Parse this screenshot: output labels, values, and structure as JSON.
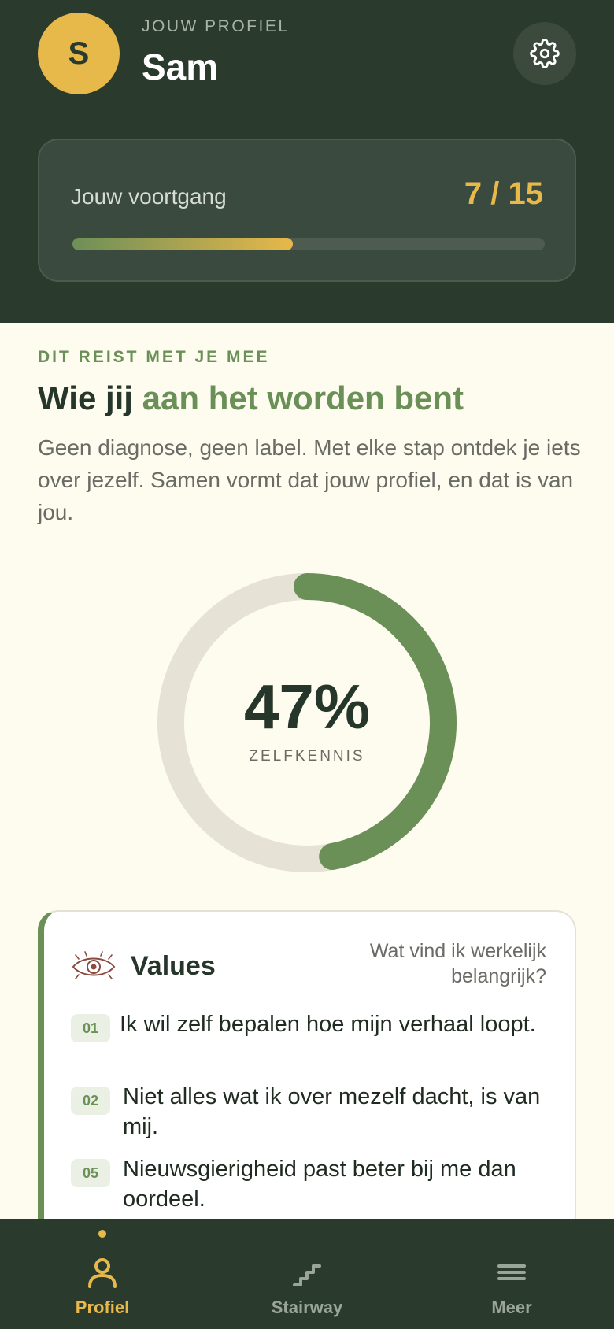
{
  "profile": {
    "avatar_initial": "S",
    "kicker": "JOUW PROFIEL",
    "name": "Sam"
  },
  "progress": {
    "label": "Jouw voortgang",
    "count": "7 / 15",
    "fraction": 0.4667
  },
  "intro": {
    "kicker": "DIT REIST MET JE MEE",
    "headline_plain": "Wie jij ",
    "headline_accent": "aan het worden bent",
    "body": "Geen diagnose, geen label. Met elke stap ontdek je iets over jezelf. Samen vormt dat jouw profiel, en dat is van jou."
  },
  "self_knowledge": {
    "value_text": "47%",
    "percent": 47,
    "label": "ZELFKENNIS"
  },
  "values_card": {
    "icon": "eye-icon",
    "title": "Values",
    "question": "Wat vind ik werkelijk belangrijk?",
    "items": [
      {
        "num": "01",
        "text": "Ik wil zelf bepalen hoe mijn verhaal loopt."
      },
      {
        "num": "02",
        "text": "Niet alles wat ik over mezelf dacht, is van mij."
      },
      {
        "num": "05",
        "text": "Nieuwsgierigheid past beter bij me dan oordeel."
      }
    ]
  },
  "tabs": [
    {
      "label": "Profiel",
      "icon": "person-icon",
      "active": true
    },
    {
      "label": "Stairway",
      "icon": "stairs-icon",
      "active": false
    },
    {
      "label": "Meer",
      "icon": "menu-icon",
      "active": false
    }
  ],
  "colors": {
    "dark_green": "#2a3a2d",
    "accent_green": "#6a9058",
    "gold": "#e7b84a",
    "cream": "#fdfcee"
  }
}
